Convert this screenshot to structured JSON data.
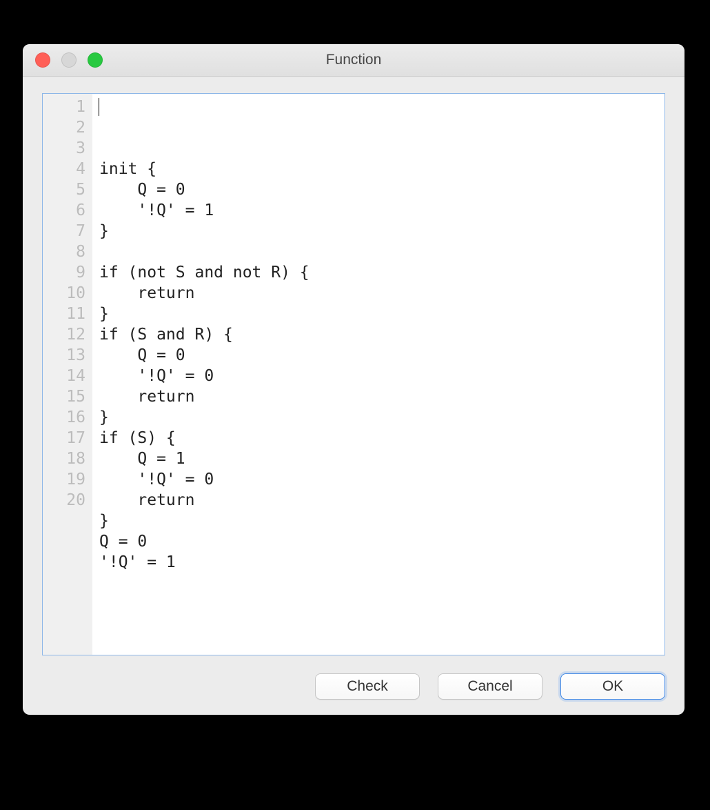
{
  "window": {
    "title": "Function"
  },
  "editor": {
    "lines": [
      "init {",
      "    Q = 0",
      "    '!Q' = 1",
      "}",
      "",
      "if (not S and not R) {",
      "    return",
      "}",
      "if (S and R) {",
      "    Q = 0",
      "    '!Q' = 0",
      "    return",
      "}",
      "if (S) {",
      "    Q = 1",
      "    '!Q' = 0",
      "    return",
      "}",
      "Q = 0",
      "'!Q' = 1"
    ]
  },
  "buttons": {
    "check": "Check",
    "cancel": "Cancel",
    "ok": "OK"
  }
}
